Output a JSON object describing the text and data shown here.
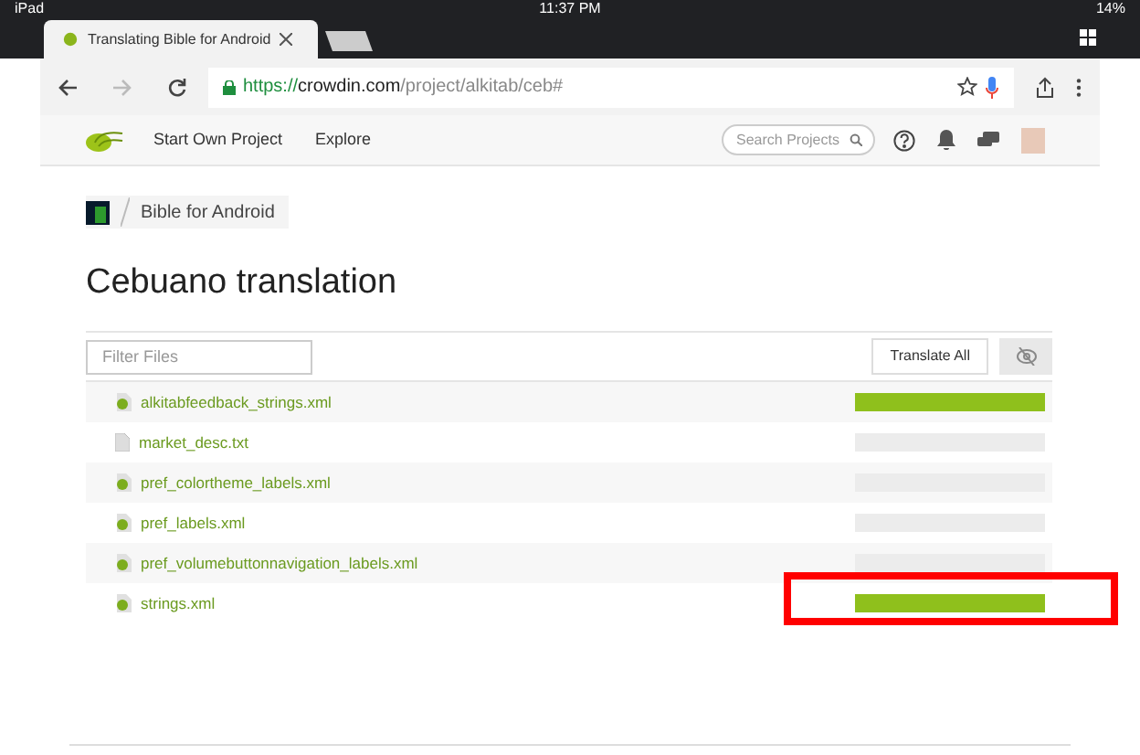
{
  "status_bar": {
    "device": "iPad",
    "time": "11:37 PM",
    "battery": "14%"
  },
  "browser": {
    "tab_title": "Translating Bible for Android",
    "url_scheme": "https://",
    "url_host": "crowdin.com",
    "url_path": "/project/alkitab/ceb#"
  },
  "nav": {
    "items": [
      "Start Own Project",
      "Explore"
    ],
    "search": {
      "placeholder": "Search Projects"
    }
  },
  "breadcrumb": "Bible for Android",
  "title": "Cebuano translation",
  "filter": {
    "placeholder": "Filter Files"
  },
  "translate_all": "Translate All",
  "files": [
    {
      "name": "alkitabfeedback_strings.xml",
      "kind": "android",
      "level": 1
    },
    {
      "name": "market_desc.txt",
      "kind": "text",
      "level": 0
    },
    {
      "name": "pref_colortheme_labels.xml",
      "kind": "android",
      "level": 0
    },
    {
      "name": "pref_labels.xml",
      "kind": "android",
      "level": 0
    },
    {
      "name": "pref_volumebuttonnavigation_labels.xml",
      "kind": "android",
      "level": 0
    },
    {
      "name": "strings.xml",
      "kind": "android",
      "level": 1,
      "highlighted": true
    }
  ]
}
